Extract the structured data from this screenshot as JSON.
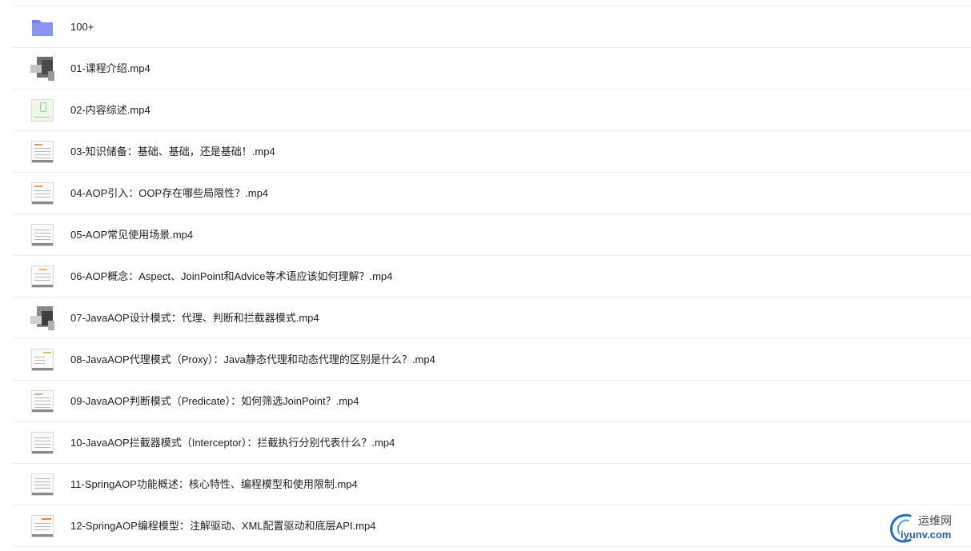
{
  "files": [
    {
      "name": "100+",
      "icon": "folder-icon"
    },
    {
      "name": "01-课程介绍.mp4",
      "icon": "video-thumbnail-icon"
    },
    {
      "name": "02-内容综述.mp4",
      "icon": "video-thumbnail-icon"
    },
    {
      "name": "03-知识储备：基础、基础，还是基础！.mp4",
      "icon": "video-thumbnail-icon"
    },
    {
      "name": "04-AOP引入：OOP存在哪些局限性？.mp4",
      "icon": "video-thumbnail-icon"
    },
    {
      "name": "05-AOP常见使用场景.mp4",
      "icon": "video-thumbnail-icon"
    },
    {
      "name": "06-AOP概念：Aspect、JoinPoint和Advice等术语应该如何理解？.mp4",
      "icon": "video-thumbnail-icon"
    },
    {
      "name": "07-JavaAOP设计模式：代理、判断和拦截器模式.mp4",
      "icon": "video-thumbnail-icon"
    },
    {
      "name": "08-JavaAOP代理模式（Proxy）：Java静态代理和动态代理的区别是什么？.mp4",
      "icon": "video-thumbnail-icon"
    },
    {
      "name": "09-JavaAOP判断模式（Predicate）：如何筛选JoinPoint？.mp4",
      "icon": "video-thumbnail-icon"
    },
    {
      "name": "10-JavaAOP拦截器模式（Interceptor）：拦截执行分别代表什么？.mp4",
      "icon": "video-thumbnail-icon"
    },
    {
      "name": "11-SpringAOP功能概述：核心特性、编程模型和使用限制.mp4",
      "icon": "video-thumbnail-icon"
    },
    {
      "name": "12-SpringAOP编程模型：注解驱动、XML配置驱动和底层API.mp4",
      "icon": "video-thumbnail-icon"
    }
  ],
  "watermark": {
    "cn": "运维网",
    "en": "iyunv.com"
  },
  "colors": {
    "folder": "#7b83ef",
    "divider": "#eeeeee",
    "text": "#222222"
  }
}
